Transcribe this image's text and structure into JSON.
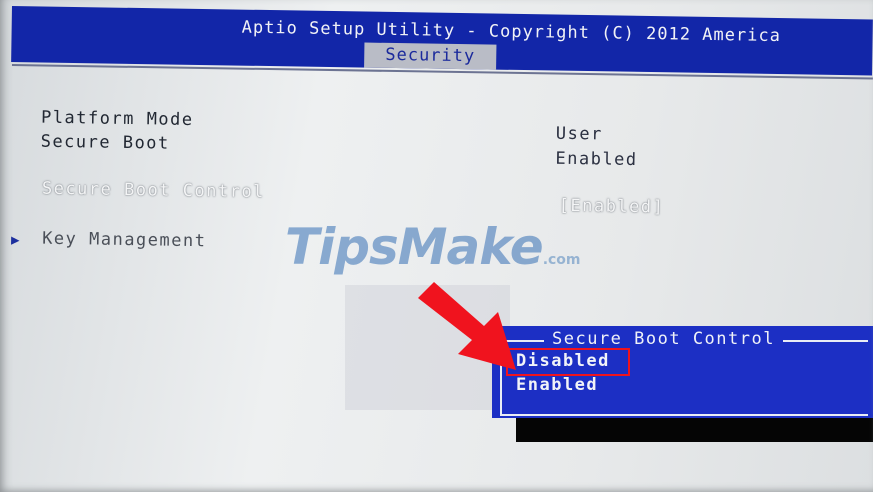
{
  "header": {
    "title": "Aptio Setup Utility - Copyright (C) 2012 America",
    "active_tab": "Security"
  },
  "settings": {
    "platform_mode": {
      "label": "Platform Mode",
      "value": "User"
    },
    "secure_boot": {
      "label": "Secure Boot",
      "value": "Enabled"
    },
    "secure_boot_control": {
      "label": "Secure Boot Control",
      "value": "[Enabled]"
    },
    "key_management": {
      "label": "Key Management"
    }
  },
  "popup": {
    "title": "Secure Boot Control",
    "options": [
      "Disabled",
      "Enabled"
    ],
    "highlighted": "Disabled"
  },
  "watermark": {
    "text": "TipsMake",
    "suffix": ".com"
  },
  "colors": {
    "bios_blue": "#1226a8",
    "popup_blue": "#1c2fc4",
    "annotation_red": "#f0131e"
  },
  "icons": {
    "submenu": "triangle-right-icon",
    "annotation": "red-arrow-icon"
  }
}
